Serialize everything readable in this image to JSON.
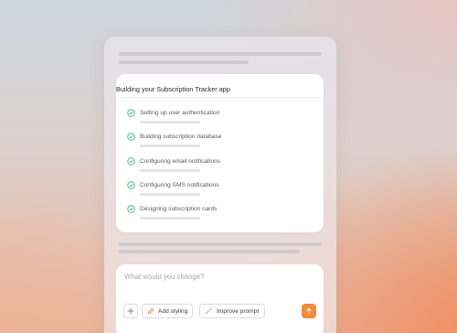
{
  "card": {
    "title": "Building your Subscription Tracker app",
    "tasks": [
      {
        "label": "Setting up user authentication",
        "done": true
      },
      {
        "label": "Building subscription database",
        "done": true
      },
      {
        "label": "Configuring email notifications",
        "done": true
      },
      {
        "label": "Configuring SMS notifications",
        "done": true
      },
      {
        "label": "Designing subscription cards",
        "done": true
      }
    ]
  },
  "composer": {
    "placeholder": "What would you change?",
    "add_styling_label": "Add styling",
    "improve_prompt_label": "Improve prompt"
  },
  "icons": {
    "check": "check-circle-icon",
    "plus": "plus-icon",
    "pencil": "pencil-icon",
    "sparkle": "sparkle-icon",
    "send": "arrow-up-icon"
  },
  "colors": {
    "check_green": "#47b37a",
    "send_orange": "#f28a3c"
  }
}
